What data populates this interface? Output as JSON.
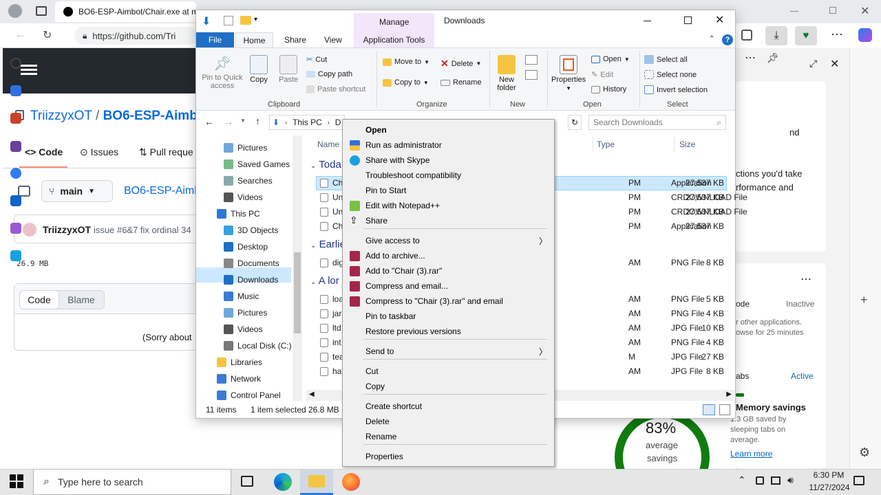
{
  "browser": {
    "tab_title": "BO6-ESP-Aimbot/Chair.exe at ma",
    "url": "https://github.com/Tri",
    "window_controls": [
      "–",
      "❐",
      "✕"
    ]
  },
  "github": {
    "owner": "TriizzyxOT",
    "separator": "/",
    "repo": "BO6-ESP-Aimbo",
    "tabs": {
      "code": "Code",
      "issues": "Issues",
      "pulls": "Pull reque"
    },
    "branch": "main",
    "repo_path": "BO6-ESP-Aimb",
    "commit_author": "TriizzyxOT",
    "commit_msg": "issue #6&7 fix ordinal 34",
    "file_size": "26.9 MB",
    "view_tabs": {
      "code": "Code",
      "blame": "Blame"
    },
    "sorry": "(Sorry about"
  },
  "edge_panel": {
    "card1_text1": "nd",
    "card1_text2": "ctions you'd take",
    "card1_text3": "rformance and",
    "mode_label": "ode",
    "mode_status": "Inactive",
    "desc1": "r other applications.",
    "desc2": "owse for 25 minutes",
    "tabs_label": "abs",
    "tabs_status": "Active",
    "mem_title": "Memory savings",
    "mem1": "1.3 GB saved by",
    "mem2": "sleeping tabs on",
    "mem3": "average.",
    "learn": "Learn more",
    "pct": "83%",
    "avg1": "average",
    "avg2": "savings"
  },
  "explorer": {
    "title": "Downloads",
    "manage": "Manage",
    "ribbon_tabs": [
      "File",
      "Home",
      "Share",
      "View",
      "Application Tools"
    ],
    "clipboard": {
      "pin": "Pin to Quick access",
      "copy": "Copy",
      "paste": "Paste",
      "cut": "Cut",
      "copy_path": "Copy path",
      "paste_shortcut": "Paste shortcut",
      "label": "Clipboard"
    },
    "organize": {
      "move_to": "Move to",
      "copy_to": "Copy to",
      "delete": "Delete",
      "rename": "Rename",
      "label": "Organize"
    },
    "new": {
      "new_folder": "New folder",
      "label": "New"
    },
    "open": {
      "properties": "Properties",
      "open": "Open",
      "edit": "Edit",
      "history": "History",
      "label": "Open"
    },
    "select": {
      "all": "Select all",
      "none": "Select none",
      "invert": "Invert selection",
      "label": "Select"
    },
    "address": {
      "this_pc": "This PC",
      "d": "D"
    },
    "search_placeholder": "Search Downloads",
    "nav": [
      "Pictures",
      "Saved Games",
      "Searches",
      "Videos",
      "This PC",
      "3D Objects",
      "Desktop",
      "Documents",
      "Downloads",
      "Music",
      "Pictures",
      "Videos",
      "Local Disk (C:)",
      "Libraries",
      "Network",
      "Control Panel"
    ],
    "columns": {
      "name": "Name",
      "type": "Type",
      "size": "Size"
    },
    "groups": [
      "Toda",
      "Earlie",
      "A lor"
    ],
    "files": [
      {
        "name": "Ch",
        "time": "PM",
        "type": "Application",
        "size": "27,537 KB"
      },
      {
        "name": "Un",
        "time": "PM",
        "type": "CRDOWNLOAD File",
        "size": "27,537 KB"
      },
      {
        "name": "Un",
        "time": "PM",
        "type": "CRDOWNLOAD File",
        "size": "27,537 KB"
      },
      {
        "name": "Ch",
        "time": "PM",
        "type": "Application",
        "size": "27,537 KB"
      },
      {
        "name": "dig",
        "time": "AM",
        "type": "PNG File",
        "size": "8 KB"
      },
      {
        "name": "loa",
        "time": "AM",
        "type": "PNG File",
        "size": "5 KB"
      },
      {
        "name": "jar",
        "time": "AM",
        "type": "PNG File",
        "size": "4 KB"
      },
      {
        "name": "ltd",
        "time": "AM",
        "type": "JPG File",
        "size": "10 KB"
      },
      {
        "name": "int",
        "time": "AM",
        "type": "PNG File",
        "size": "4 KB"
      },
      {
        "name": "tea",
        "time": "M",
        "type": "JPG File",
        "size": "27 KB"
      },
      {
        "name": "hay",
        "time": "AM",
        "type": "JPG File",
        "size": "8 KB"
      }
    ],
    "status": {
      "items": "11 items",
      "selected": "1 item selected",
      "size": "26.8 MB"
    }
  },
  "context_menu": [
    {
      "label": "Open",
      "bold": true
    },
    {
      "label": "Run as administrator",
      "icon": "shield-icon"
    },
    {
      "label": "Share with Skype",
      "icon": "skype-icon"
    },
    {
      "label": "Troubleshoot compatibility"
    },
    {
      "label": "Pin to Start"
    },
    {
      "label": "Edit with Notepad++",
      "icon": "notepad-icon"
    },
    {
      "label": "Share",
      "icon": "share-icon"
    },
    {
      "label": "Give access to",
      "submenu": true
    },
    {
      "label": "Add to archive...",
      "icon": "winrar-icon"
    },
    {
      "label": "Add to \"Chair (3).rar\"",
      "icon": "winrar-icon"
    },
    {
      "label": "Compress and email...",
      "icon": "winrar-icon"
    },
    {
      "label": "Compress to \"Chair (3).rar\" and email",
      "icon": "winrar-icon"
    },
    {
      "label": "Pin to taskbar"
    },
    {
      "label": "Restore previous versions"
    },
    {
      "label": "Send to",
      "submenu": true
    },
    {
      "label": "Cut"
    },
    {
      "label": "Copy"
    },
    {
      "label": "Create shortcut"
    },
    {
      "label": "Delete"
    },
    {
      "label": "Rename"
    },
    {
      "label": "Properties"
    }
  ],
  "taskbar": {
    "search": "Type here to search",
    "time": "6:30 PM",
    "date": "11/27/2024"
  },
  "colors": {
    "accent": "#0078d4",
    "manage": "#f3e6fa",
    "github_dark": "#24292f"
  }
}
